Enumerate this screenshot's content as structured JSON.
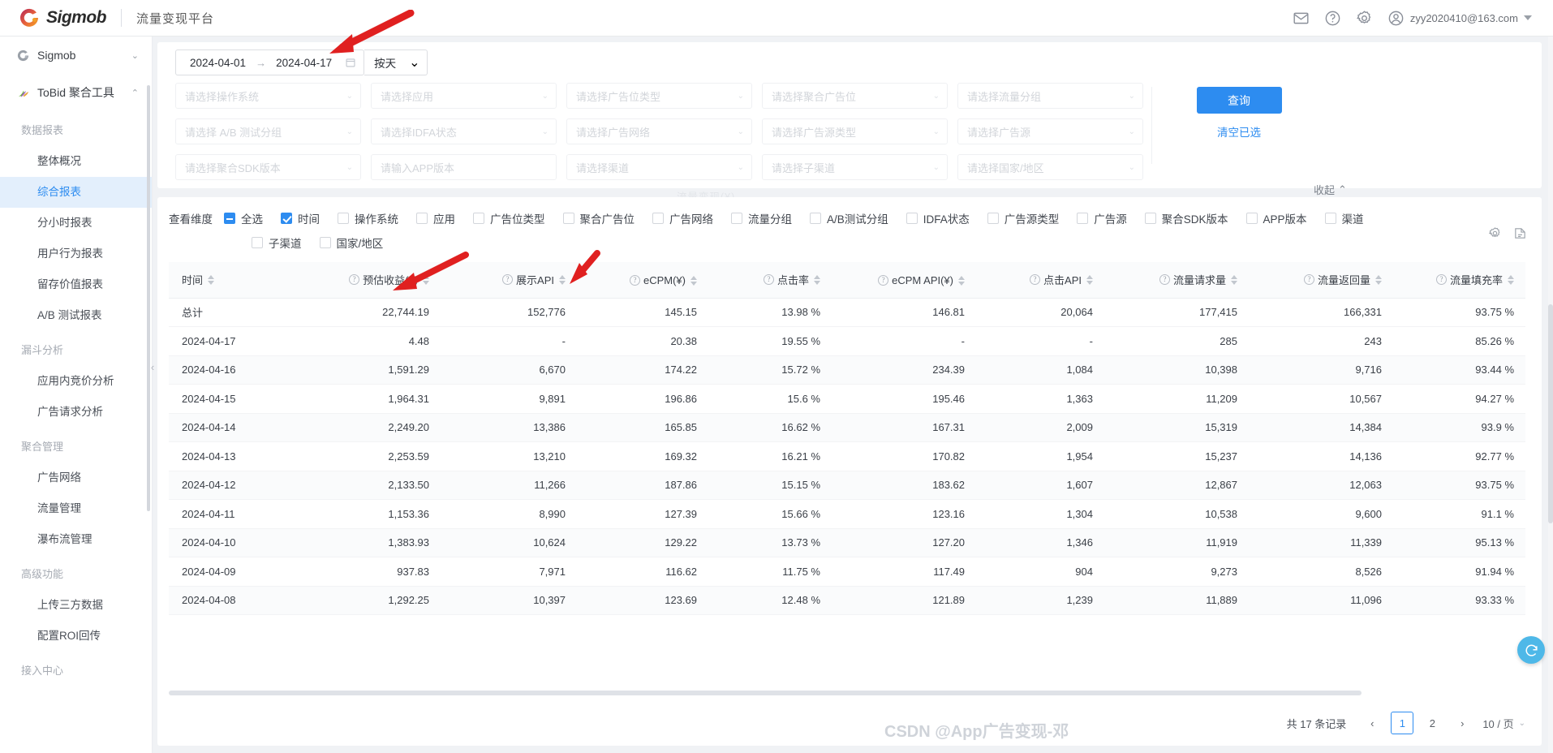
{
  "header": {
    "brand_name": "Sigmob",
    "brand_sub": "流量变现平台",
    "icons": [
      "mail-icon",
      "help-icon",
      "settings-icon"
    ],
    "user_email": "zyy2020410@163.com"
  },
  "sidebar": {
    "groups": [
      {
        "name": "Sigmob",
        "icon": "sigmob-icon",
        "chevron": "⌄",
        "expanded": false
      },
      {
        "name": "ToBid 聚合工具",
        "icon": "tobid-icon",
        "chevron": "⌃",
        "expanded": true
      }
    ],
    "sections": [
      {
        "title": "数据报表",
        "items": [
          {
            "label": "整体概况",
            "active": false
          },
          {
            "label": "综合报表",
            "active": true
          },
          {
            "label": "分小时报表",
            "active": false
          },
          {
            "label": "用户行为报表",
            "active": false
          },
          {
            "label": "留存价值报表",
            "active": false
          },
          {
            "label": "A/B 测试报表",
            "active": false
          }
        ]
      },
      {
        "title": "漏斗分析",
        "items": [
          {
            "label": "应用内竞价分析",
            "active": false
          },
          {
            "label": "广告请求分析",
            "active": false
          }
        ]
      },
      {
        "title": "聚合管理",
        "items": [
          {
            "label": "广告网络",
            "active": false
          },
          {
            "label": "流量管理",
            "active": false
          },
          {
            "label": "瀑布流管理",
            "active": false
          }
        ]
      },
      {
        "title": "高级功能",
        "items": [
          {
            "label": "上传三方数据",
            "active": false
          },
          {
            "label": "配置ROI回传",
            "active": false
          }
        ]
      },
      {
        "title": "接入中心",
        "items": []
      }
    ]
  },
  "filters": {
    "date_start": "2024-04-01",
    "date_end": "2024-04-17",
    "date_arrow": "→",
    "granularity": "按天",
    "selects": [
      "请选择操作系统",
      "请选择应用",
      "请选择广告位类型",
      "请选择聚合广告位",
      "请选择流量分组",
      "请选择 A/B 测试分组",
      "请选择IDFA状态",
      "请选择广告网络",
      "请选择广告源类型",
      "请选择广告源",
      "请选择聚合SDK版本",
      "请输入APP版本",
      "请选择渠道",
      "请选择子渠道",
      "请选择国家/地区"
    ],
    "query_label": "查询",
    "clear_label": "清空已选",
    "collapse_label": "收起",
    "ghost_tab": "流量变现(¥)"
  },
  "dimensions": {
    "label": "查看维度",
    "items": [
      {
        "label": "全选",
        "state": "indeterminate"
      },
      {
        "label": "时间",
        "state": "checked"
      },
      {
        "label": "操作系统",
        "state": "unchecked"
      },
      {
        "label": "应用",
        "state": "unchecked"
      },
      {
        "label": "广告位类型",
        "state": "unchecked"
      },
      {
        "label": "聚合广告位",
        "state": "unchecked"
      },
      {
        "label": "广告网络",
        "state": "unchecked"
      },
      {
        "label": "流量分组",
        "state": "unchecked"
      },
      {
        "label": "A/B测试分组",
        "state": "unchecked"
      },
      {
        "label": "IDFA状态",
        "state": "unchecked"
      },
      {
        "label": "广告源类型",
        "state": "unchecked"
      },
      {
        "label": "广告源",
        "state": "unchecked"
      },
      {
        "label": "聚合SDK版本",
        "state": "unchecked"
      },
      {
        "label": "APP版本",
        "state": "unchecked"
      },
      {
        "label": "渠道",
        "state": "unchecked"
      }
    ],
    "items_row2": [
      {
        "label": "子渠道",
        "state": "unchecked"
      },
      {
        "label": "国家/地区",
        "state": "unchecked"
      }
    ]
  },
  "table": {
    "columns": [
      {
        "label": "时间",
        "help": false,
        "sortable": true
      },
      {
        "label": "预估收益(¥)",
        "help": true,
        "sortable": true
      },
      {
        "label": "展示API",
        "help": true,
        "sortable": true
      },
      {
        "label": "eCPM(¥)",
        "help": true,
        "sortable": true
      },
      {
        "label": "点击率",
        "help": true,
        "sortable": true
      },
      {
        "label": "eCPM API(¥)",
        "help": true,
        "sortable": true
      },
      {
        "label": "点击API",
        "help": true,
        "sortable": true
      },
      {
        "label": "流量请求量",
        "help": true,
        "sortable": true
      },
      {
        "label": "流量返回量",
        "help": true,
        "sortable": true
      },
      {
        "label": "流量填充率",
        "help": true,
        "sortable": true
      }
    ],
    "rows": [
      [
        "总计",
        "22,744.19",
        "152,776",
        "145.15",
        "13.98 %",
        "146.81",
        "20,064",
        "177,415",
        "166,331",
        "93.75 %"
      ],
      [
        "2024-04-17",
        "4.48",
        "-",
        "20.38",
        "19.55 %",
        "-",
        "-",
        "285",
        "243",
        "85.26 %"
      ],
      [
        "2024-04-16",
        "1,591.29",
        "6,670",
        "174.22",
        "15.72 %",
        "234.39",
        "1,084",
        "10,398",
        "9,716",
        "93.44 %"
      ],
      [
        "2024-04-15",
        "1,964.31",
        "9,891",
        "196.86",
        "15.6 %",
        "195.46",
        "1,363",
        "11,209",
        "10,567",
        "94.27 %"
      ],
      [
        "2024-04-14",
        "2,249.20",
        "13,386",
        "165.85",
        "16.62 %",
        "167.31",
        "2,009",
        "15,319",
        "14,384",
        "93.9 %"
      ],
      [
        "2024-04-13",
        "2,253.59",
        "13,210",
        "169.32",
        "16.21 %",
        "170.82",
        "1,954",
        "15,237",
        "14,136",
        "92.77 %"
      ],
      [
        "2024-04-12",
        "2,133.50",
        "11,266",
        "187.86",
        "15.15 %",
        "183.62",
        "1,607",
        "12,867",
        "12,063",
        "93.75 %"
      ],
      [
        "2024-04-11",
        "1,153.36",
        "8,990",
        "127.39",
        "15.66 %",
        "123.16",
        "1,304",
        "10,538",
        "9,600",
        "91.1 %"
      ],
      [
        "2024-04-10",
        "1,383.93",
        "10,624",
        "129.22",
        "13.73 %",
        "127.20",
        "1,346",
        "11,919",
        "11,339",
        "95.13 %"
      ],
      [
        "2024-04-09",
        "937.83",
        "7,971",
        "116.62",
        "11.75 %",
        "117.49",
        "904",
        "9,273",
        "8,526",
        "91.94 %"
      ],
      [
        "2024-04-08",
        "1,292.25",
        "10,397",
        "123.69",
        "12.48 %",
        "121.89",
        "1,239",
        "11,889",
        "11,096",
        "93.33 %"
      ]
    ]
  },
  "pagination": {
    "total_text": "共 17 条记录",
    "prev": "‹",
    "next": "›",
    "pages": [
      "1",
      "2"
    ],
    "current": "1",
    "page_size": "10 / 页"
  },
  "watermark": "CSDN @App广告变现-邓",
  "colors": {
    "accent": "#2d8cf0",
    "arrow_red": "#e02020",
    "fab": "#4eb8e8"
  }
}
